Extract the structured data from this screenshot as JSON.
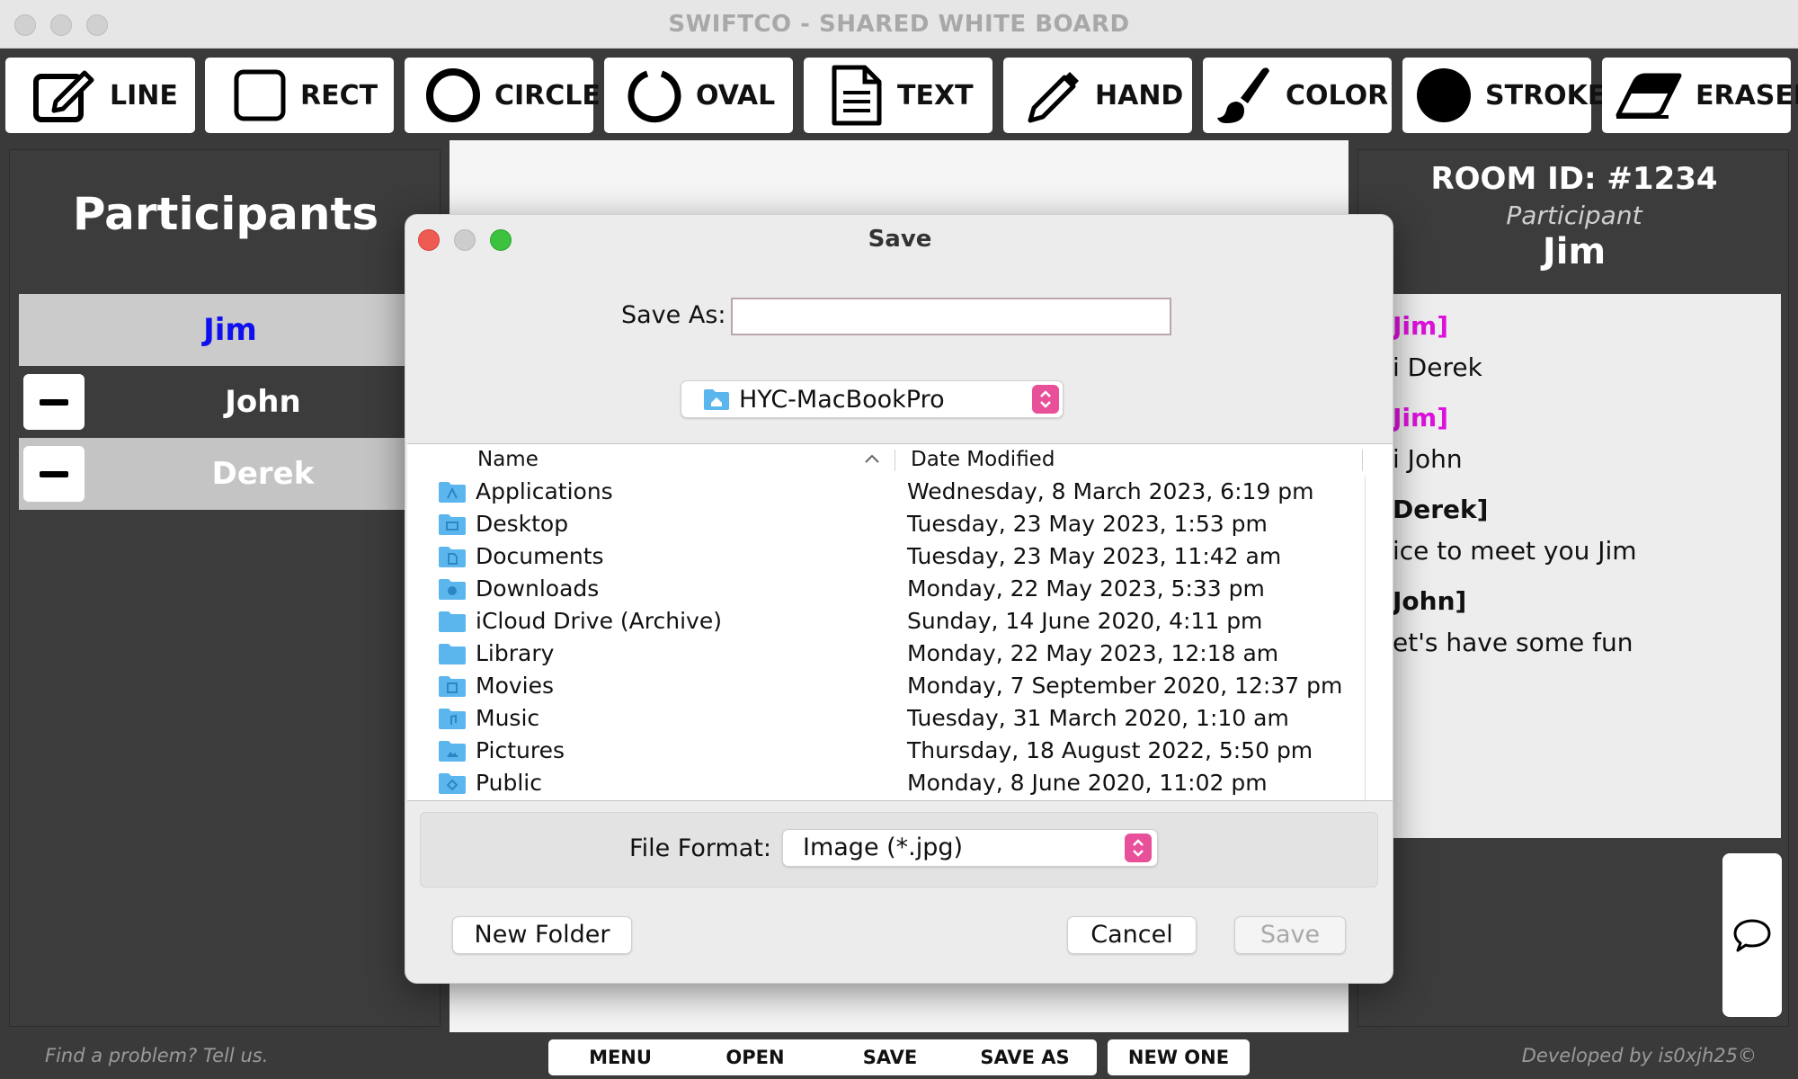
{
  "window": {
    "title": "SWIFTCO - SHARED WHITE BOARD"
  },
  "toolbar": {
    "tools": [
      {
        "label": "LINE",
        "icon": "pencil-square-icon"
      },
      {
        "label": "RECT",
        "icon": "rounded-square-icon"
      },
      {
        "label": "CIRCLE",
        "icon": "circle-outline-icon"
      },
      {
        "label": "OVAL",
        "icon": "oval-arc-icon"
      },
      {
        "label": "TEXT",
        "icon": "document-icon"
      },
      {
        "label": "HAND",
        "icon": "pencil-icon"
      },
      {
        "label": "COLOR",
        "icon": "paintbrush-icon"
      },
      {
        "label": "STROKE",
        "icon": "filled-circle-icon"
      },
      {
        "label": "ERASER",
        "icon": "eraser-icon"
      }
    ]
  },
  "participants": {
    "title": "Participants",
    "list": [
      {
        "name": "Jim",
        "color": "#1010ee",
        "removable": false
      },
      {
        "name": "John",
        "color": "#ffffff",
        "removable": true
      },
      {
        "name": "Derek",
        "color": "#ffffff",
        "removable": true
      }
    ]
  },
  "room": {
    "id_label": "ROOM ID: #1234",
    "role": "Participant",
    "user": "Jim"
  },
  "chat": {
    "messages": [
      {
        "from": "Jim]",
        "from_color": "#dd11dd",
        "text": "i Derek"
      },
      {
        "from": "Jim]",
        "from_color": "#dd11dd",
        "text": "i John"
      },
      {
        "from": "Derek]",
        "from_color": "#111111",
        "text": "ice to meet you Jim"
      },
      {
        "from": "John]",
        "from_color": "#111111",
        "text": "et's have some fun"
      }
    ]
  },
  "bottom": {
    "feedback": "Find a problem? Tell us.",
    "credits": "Developed by is0xjh25©",
    "buttons": [
      "MENU",
      "OPEN",
      "SAVE",
      "SAVE AS",
      "NEW ONE"
    ]
  },
  "dialog": {
    "title": "Save",
    "save_as_label": "Save As:",
    "save_as_value": "",
    "location": "HYC-MacBookPro",
    "columns": {
      "name": "Name",
      "date": "Date Modified"
    },
    "files": [
      {
        "name": "Applications",
        "date": "Wednesday, 8 March 2023, 6:19 pm"
      },
      {
        "name": "Desktop",
        "date": "Tuesday, 23 May 2023, 1:53 pm"
      },
      {
        "name": "Documents",
        "date": "Tuesday, 23 May 2023, 11:42 am"
      },
      {
        "name": "Downloads",
        "date": "Monday, 22 May 2023, 5:33 pm"
      },
      {
        "name": "iCloud Drive (Archive)",
        "date": "Sunday, 14 June 2020, 4:11 pm"
      },
      {
        "name": "Library",
        "date": "Monday, 22 May 2023, 12:18 am"
      },
      {
        "name": "Movies",
        "date": "Monday, 7 September 2020, 12:37 pm"
      },
      {
        "name": "Music",
        "date": "Tuesday, 31 March 2020, 1:10 am"
      },
      {
        "name": "Pictures",
        "date": "Thursday, 18 August 2022, 5:50 pm"
      },
      {
        "name": "Public",
        "date": "Monday, 8 June 2020, 11:02 pm"
      }
    ],
    "format_label": "File Format:",
    "format_value": "Image (*.jpg)",
    "new_folder_label": "New Folder",
    "cancel_label": "Cancel",
    "save_label": "Save"
  },
  "colors": {
    "accent_pink": "#e8509a",
    "participant_self": "#1010ee",
    "chat_name_self": "#dd11dd",
    "close_red": "#ee5b52",
    "minimize_gray": "#cdcdcd",
    "zoom_green": "#3cc23f"
  }
}
